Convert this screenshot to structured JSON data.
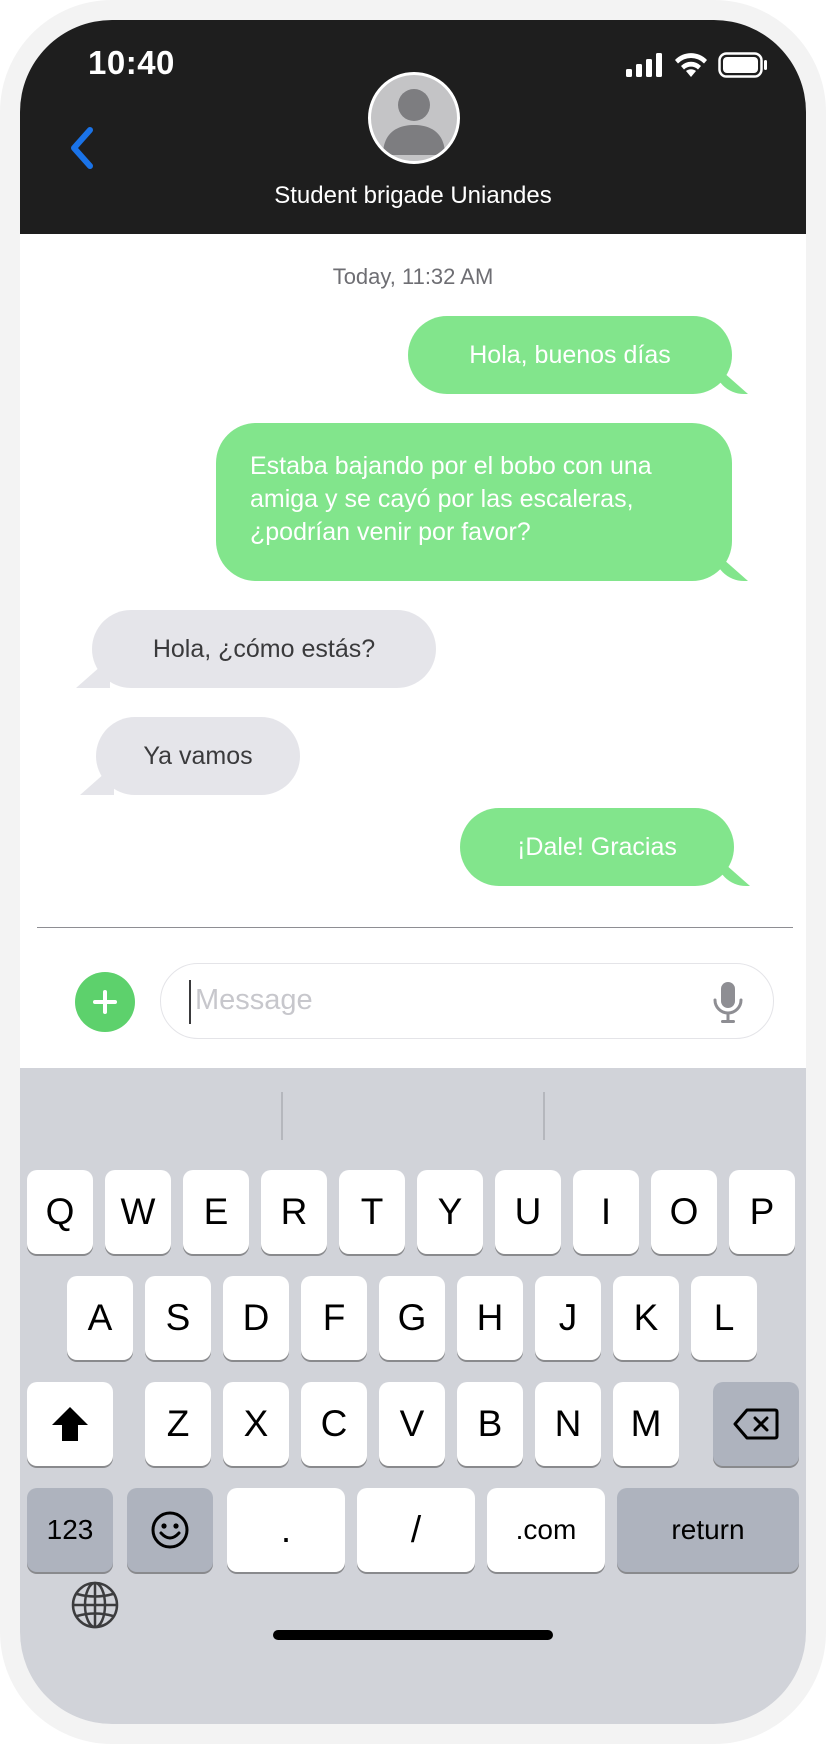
{
  "status_bar": {
    "time": "10:40"
  },
  "header": {
    "contact_name": "Student brigade Uniandes",
    "avatar_icon": "person-silhouette-icon",
    "back_icon": "chevron-left-icon"
  },
  "conversation": {
    "timestamp": "Today, 11:32 AM",
    "messages": [
      {
        "from": "me",
        "text": "Hola, buenos días"
      },
      {
        "from": "me",
        "lines": [
          "Estaba bajando por el bobo con una",
          "amiga y se cayó por las escaleras,",
          "¿podrían venir por favor?"
        ]
      },
      {
        "from": "them",
        "text": "Hola, ¿cómo estás?"
      },
      {
        "from": "them",
        "text": "Ya vamos"
      },
      {
        "from": "me",
        "text": "¡Dale! Gracias"
      }
    ]
  },
  "composer": {
    "placeholder": "Message",
    "value": "",
    "plus_icon": "plus-icon",
    "mic_icon": "microphone-icon"
  },
  "keyboard": {
    "row1": [
      "Q",
      "W",
      "E",
      "R",
      "T",
      "Y",
      "U",
      "I",
      "O",
      "P"
    ],
    "row2": [
      "A",
      "S",
      "D",
      "F",
      "G",
      "H",
      "J",
      "K",
      "L"
    ],
    "row3": [
      "Z",
      "X",
      "C",
      "V",
      "B",
      "N",
      "M"
    ],
    "row4": {
      "numbers": "123",
      "period": ".",
      "slash": "/",
      "dotcom": ".com",
      "return": "return"
    },
    "shift_icon": "shift-icon",
    "delete_icon": "delete-backspace-icon",
    "emoji_icon": "emoji-icon",
    "globe_icon": "globe-icon"
  },
  "colors": {
    "sent_bubble": "#82e58c",
    "received_bubble": "#e5e5ea",
    "header_bg": "#1e1e1e",
    "accent_blue": "#1a73e8",
    "plus_green": "#5dd16c"
  }
}
